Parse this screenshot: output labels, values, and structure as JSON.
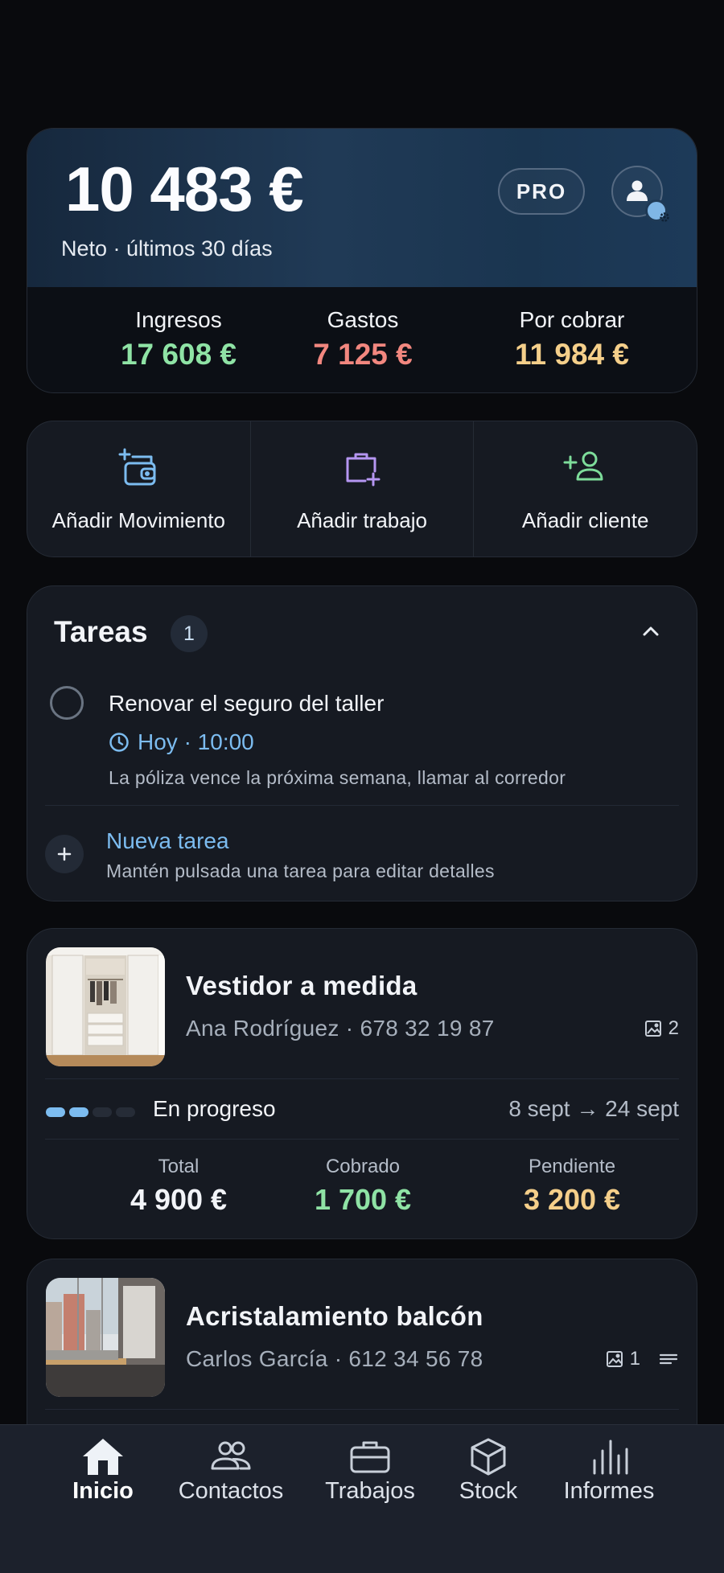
{
  "summary": {
    "net_amount": "10 483 €",
    "net_label": "Neto · últimos 30 días",
    "pro_badge": "PRO",
    "profile_icon": "user-settings-icon",
    "stats": [
      {
        "label": "Ingresos",
        "value": "17 608 €",
        "color": "#8fe3a5"
      },
      {
        "label": "Gastos",
        "value": "7 125 €",
        "color": "#f2877f"
      },
      {
        "label": "Por cobrar",
        "value": "11 984 €",
        "color": "#f5cf8a"
      }
    ]
  },
  "quick_actions": [
    {
      "label": "Añadir Movimiento",
      "icon": "add-wallet-icon",
      "color": "#7cbcf0"
    },
    {
      "label": "Añadir trabajo",
      "icon": "add-briefcase-icon",
      "color": "#b596f2"
    },
    {
      "label": "Añadir cliente",
      "icon": "add-user-icon",
      "color": "#7ddc9a"
    }
  ],
  "tasks": {
    "title": "Tareas",
    "count": "1",
    "items": [
      {
        "title": "Renovar el seguro del taller",
        "time": "Hoy · 10:00",
        "note": "La póliza vence la próxima semana, llamar al corredor"
      }
    ],
    "new_task_label": "Nueva tarea",
    "new_task_hint": "Mantén pulsada una tarea para editar detalles"
  },
  "jobs": [
    {
      "title": "Vestidor a medida",
      "client": "Ana Rodríguez",
      "phone": "· 678 32 19 87",
      "photo_count": "2",
      "status": "En progreso",
      "dates": "8 sept → 24 sept",
      "progress": {
        "done": 2,
        "total": 4
      },
      "total_label": "Total",
      "total_value": "4 900 €",
      "paid_label": "Cobrado",
      "paid_value": "1 700 €",
      "pending_label": "Pendiente",
      "pending_value": "3 200 €"
    },
    {
      "title": "Acristalamiento balcón",
      "client": "Carlos García",
      "phone": "· 612 34 56 78",
      "photo_count": "1"
    }
  ],
  "nav": [
    {
      "label": "Inicio",
      "icon": "home-icon",
      "active": true
    },
    {
      "label": "Contactos",
      "icon": "contacts-icon"
    },
    {
      "label": "Trabajos",
      "icon": "briefcase-icon"
    },
    {
      "label": "Stock",
      "icon": "box-icon"
    },
    {
      "label": "Informes",
      "icon": "bar-chart-icon"
    }
  ],
  "colors": {
    "accent_blue": "#7cbcf0",
    "income_green": "#8fe3a5",
    "expense_red": "#f2877f",
    "pending_yellow": "#f5cf8a"
  }
}
